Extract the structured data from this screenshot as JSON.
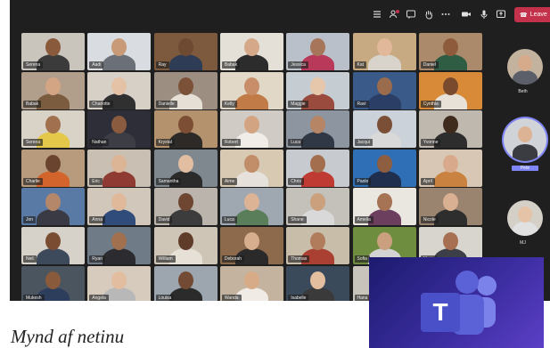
{
  "toolbar": {
    "title": "Teams call",
    "icons": [
      "list-icon",
      "people-icon",
      "chat-icon",
      "raise-hand-icon",
      "more-icon",
      "camera-icon",
      "mic-icon",
      "share-icon"
    ],
    "leave_label": "Leave"
  },
  "grid": {
    "participants": [
      {
        "name": "Serena",
        "bg": "#c9c4bc",
        "skin": "#8a5a3c",
        "shirt": "#3b3b3b"
      },
      {
        "name": "Aadi",
        "bg": "#d9dde2",
        "skin": "#c89a77",
        "shirt": "#6a6f78"
      },
      {
        "name": "Ray",
        "bg": "#7d5a3e",
        "skin": "#6d4a31",
        "shirt": "#2f3c55"
      },
      {
        "name": "Babak",
        "bg": "#e4e0d8",
        "skin": "#d4a889",
        "shirt": "#2c2c2c"
      },
      {
        "name": "Jessica",
        "bg": "#b9c0c9",
        "skin": "#a77559",
        "shirt": "#b8395a"
      },
      {
        "name": "Kat",
        "bg": "#c7a982",
        "skin": "#e2b89a",
        "shirt": "#d8d3cb"
      },
      {
        "name": "Daniel",
        "bg": "#aa8a6a",
        "skin": "#8e5c3d",
        "shirt": "#2f5d43"
      },
      {
        "name": "Babak",
        "bg": "#b19f8b",
        "skin": "#d3a585",
        "shirt": "#7b5c3f"
      },
      {
        "name": "Charlotte",
        "bg": "#d6d0c6",
        "skin": "#e4c2a5",
        "shirt": "#303030"
      },
      {
        "name": "Danielle",
        "bg": "#9c8f82",
        "skin": "#7b5138",
        "shirt": "#e6dfd5"
      },
      {
        "name": "Kelly",
        "bg": "#e2d8c8",
        "skin": "#c78e69",
        "shirt": "#c07b47"
      },
      {
        "name": "Maggie",
        "bg": "#c5ccd2",
        "skin": "#e7c7ab",
        "shirt": "#9a4b3e"
      },
      {
        "name": "Ravi",
        "bg": "#3a5b8a",
        "skin": "#9a6b4c",
        "shirt": "#2b3f66"
      },
      {
        "name": "Cynthia",
        "bg": "#d98a39",
        "skin": "#7a4a2e",
        "shirt": "#e8e1d8"
      },
      {
        "name": "Serena",
        "bg": "#d9d2c6",
        "skin": "#a0704f",
        "shirt": "#e3c84a"
      },
      {
        "name": "Nathan",
        "bg": "#2e2e38",
        "skin": "#8a5b3e",
        "shirt": "#3d3d45"
      },
      {
        "name": "Krystal",
        "bg": "#b4926e",
        "skin": "#7c4e33",
        "shirt": "#2d2a28"
      },
      {
        "name": "Robert",
        "bg": "#d0cbc4",
        "skin": "#d3a482",
        "shirt": "#f0ede8"
      },
      {
        "name": "Luca",
        "bg": "#8d96a0",
        "skin": "#b58565",
        "shirt": "#303846"
      },
      {
        "name": "Jacqui",
        "bg": "#ccd2da",
        "skin": "#7a4f36",
        "shirt": "#d9d9d9"
      },
      {
        "name": "Yvonne",
        "bg": "#bfb8ae",
        "skin": "#3f2a1e",
        "shirt": "#2d2d2d"
      },
      {
        "name": "Charlie",
        "bg": "#b89b7d",
        "skin": "#6b4430",
        "shirt": "#d3642c"
      },
      {
        "name": "Eric",
        "bg": "#c9bfb2",
        "skin": "#dcb596",
        "shirt": "#8f3b34"
      },
      {
        "name": "Samantha",
        "bg": "#7f878f",
        "skin": "#e1bea1",
        "shirt": "#2b2b2b"
      },
      {
        "name": "Aime",
        "bg": "#d8c9b3",
        "skin": "#c08d68",
        "shirt": "#e6e1da"
      },
      {
        "name": "Chris",
        "bg": "#c7cbd0",
        "skin": "#a36e4e",
        "shirt": "#bf3a32"
      },
      {
        "name": "Paolo",
        "bg": "#2f6fb5",
        "skin": "#8e5e40",
        "shirt": "#1f2f4d"
      },
      {
        "name": "April",
        "bg": "#d7c7b4",
        "skin": "#d8a98a",
        "shirt": "#c9823f"
      },
      {
        "name": "Jon",
        "bg": "#5a7aa6",
        "skin": "#b5876a",
        "shirt": "#3a3a44"
      },
      {
        "name": "Anna",
        "bg": "#d2c7bb",
        "skin": "#e0b99b",
        "shirt": "#304c7a"
      },
      {
        "name": "David",
        "bg": "#bab4ac",
        "skin": "#6e4631",
        "shirt": "#3c3c3c"
      },
      {
        "name": "Luca",
        "bg": "#9fa7b0",
        "skin": "#ddb396",
        "shirt": "#5a7d5a"
      },
      {
        "name": "Shane",
        "bg": "#c4c0ba",
        "skin": "#caa07d",
        "shirt": "#d9d9d9"
      },
      {
        "name": "Amelia",
        "bg": "#eae6e0",
        "skin": "#a67354",
        "shirt": "#6d3f5e"
      },
      {
        "name": "Nicole",
        "bg": "#9a8470",
        "skin": "#d9b092",
        "shirt": "#2e2e2e"
      },
      {
        "name": "Neil",
        "bg": "#d7d2c9",
        "skin": "#7a4d33",
        "shirt": "#3c4a5c"
      },
      {
        "name": "Ryan",
        "bg": "#6f7b87",
        "skin": "#a0704f",
        "shirt": "#2b2b30"
      },
      {
        "name": "William",
        "bg": "#cfc5b7",
        "skin": "#5f3c2a",
        "shirt": "#e6e0d7"
      },
      {
        "name": "Deborah",
        "bg": "#8e6a4d",
        "skin": "#d7ae8e",
        "shirt": "#2a2a2a"
      },
      {
        "name": "Thomas",
        "bg": "#c8bda9",
        "skin": "#b07c5c",
        "shirt": "#aa4032"
      },
      {
        "name": "Sofia",
        "bg": "#6e8d3e",
        "skin": "#caa07f",
        "shirt": "#d3d3d3"
      },
      {
        "name": "Maria",
        "bg": "#d8d4ce",
        "skin": "#a77052",
        "shirt": "#3d3f48"
      },
      {
        "name": "Mukesh",
        "bg": "#4b5560",
        "skin": "#8a5a3c",
        "shirt": "#2c3e5c"
      },
      {
        "name": "Angela",
        "bg": "#d6cbbd",
        "skin": "#e2bd9f",
        "shirt": "#b8b8b8"
      },
      {
        "name": "Louisa",
        "bg": "#9da6af",
        "skin": "#734a33",
        "shirt": "#2b2b2b"
      },
      {
        "name": "Wanda",
        "bg": "#c4b49f",
        "skin": "#d7aa88",
        "shirt": "#f0ebe4"
      },
      {
        "name": "Isabelle",
        "bg": "#3b4a5a",
        "skin": "#e3bf9f",
        "shirt": "#3a3a3a"
      },
      {
        "name": "Hana",
        "bg": "#c8c3bb",
        "skin": "#a56f50",
        "shirt": "#cd6a3d"
      }
    ]
  },
  "rail": [
    {
      "name": "Beth",
      "bg": "#c3b29e",
      "skin": "#d6ab8b",
      "shirt": "#5a5f6a",
      "active": false
    },
    {
      "name": "Pete",
      "bg": "#d0d3d8",
      "skin": "#dcb394",
      "shirt": "#3b3b42",
      "active": true
    },
    {
      "name": "MJ",
      "bg": "#d4cfc7",
      "skin": "#e4c3a6",
      "shirt": "#e1e1e1",
      "active": false
    }
  ],
  "caption": "Mynd af netinu",
  "logo": {
    "letter": "T",
    "product": "Microsoft Teams"
  },
  "colors": {
    "accent": "#7f85f5",
    "leave": "#c4314b",
    "window_bg": "#1f1f1f"
  }
}
